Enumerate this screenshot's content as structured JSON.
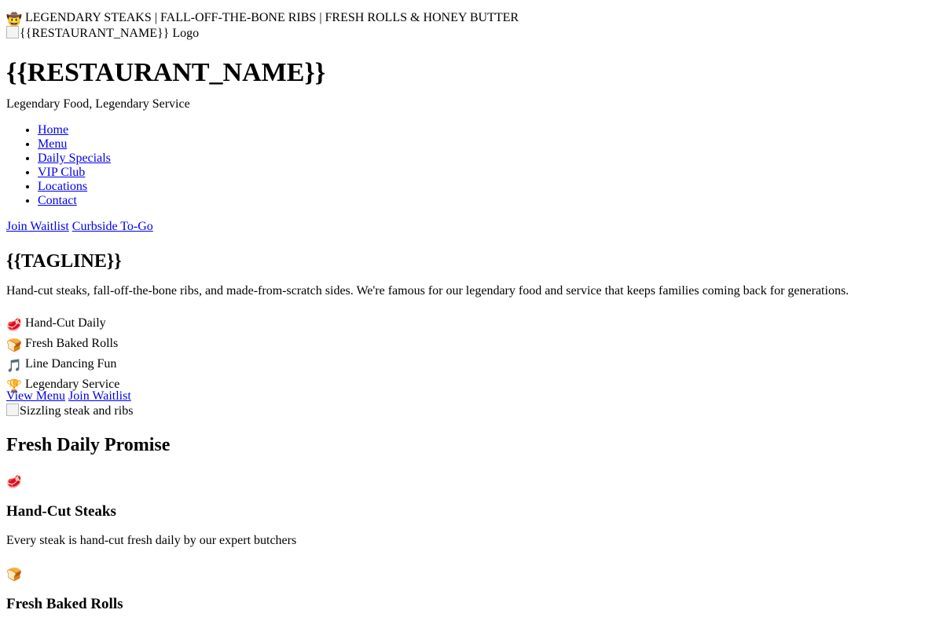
{
  "announcement": {
    "icon": "cowboy-hat-icon",
    "text": "LEGENDARY STEAKS | FALL-OFF-THE-BONE RIBS | FRESH ROLLS & HONEY BUTTER"
  },
  "header": {
    "logo_alt": "{{RESTAURANT_NAME}} Logo",
    "restaurant_name": "{{RESTAURANT_NAME}}",
    "slogan": "Legendary Food, Legendary Service"
  },
  "nav": {
    "items": [
      {
        "label": "Home"
      },
      {
        "label": "Menu"
      },
      {
        "label": "Daily Specials"
      },
      {
        "label": "VIP Club"
      },
      {
        "label": "Locations"
      },
      {
        "label": "Contact"
      }
    ]
  },
  "header_ctas": {
    "waitlist": "Join Waitlist",
    "curbside": "Curbside To-Go"
  },
  "hero": {
    "tagline": "{{TAGLINE}}",
    "description": "Hand-cut steaks, fall-off-the-bone ribs, and made-from-scratch sides. We're famous for our legendary food and service that keeps families coming back for generations.",
    "features": [
      {
        "icon": "steak-icon",
        "label": "Hand-Cut Daily"
      },
      {
        "icon": "bread-icon",
        "label": "Fresh Baked Rolls"
      },
      {
        "icon": "music-note-icon",
        "label": "Line Dancing Fun"
      },
      {
        "icon": "trophy-icon",
        "label": "Legendary Service"
      }
    ],
    "cta_menu": "View Menu",
    "cta_waitlist": "Join Waitlist",
    "image_alt": "Sizzling steak and ribs"
  },
  "promise": {
    "title": "Fresh Daily Promise",
    "cards": [
      {
        "icon": "steak-icon",
        "title": "Hand-Cut Steaks",
        "description": "Every steak is hand-cut fresh daily by our expert butchers"
      },
      {
        "icon": "bread-icon",
        "title": "Fresh Baked Rolls",
        "description": ""
      }
    ]
  },
  "colors": {
    "link": "#0000ee",
    "text": "#000000",
    "background": "#ffffff"
  }
}
